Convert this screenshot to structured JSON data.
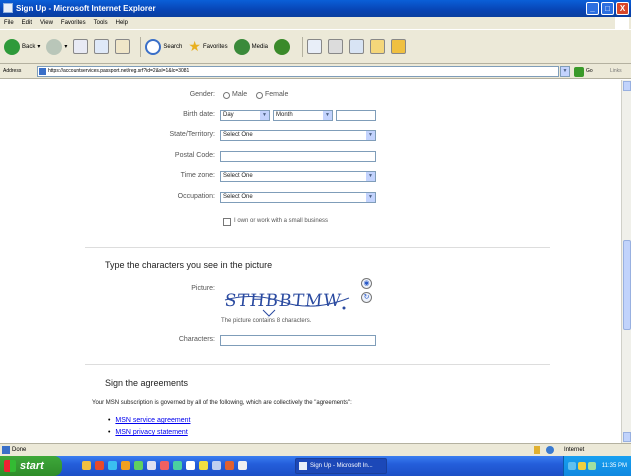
{
  "window": {
    "title": "Sign Up - Microsoft Internet Explorer",
    "buttons": [
      "_",
      "□",
      "X"
    ]
  },
  "menu": [
    "File",
    "Edit",
    "View",
    "Favorites",
    "Tools",
    "Help"
  ],
  "toolbar": {
    "back": "Back",
    "search": "Search",
    "favorites": "Favorites",
    "media": "Media"
  },
  "address": {
    "label": "Address",
    "url": "https://accountservices.passport.net/reg.srf?id=2&sl=1&lc=3081",
    "go": "Go",
    "links": "Links"
  },
  "form": {
    "gender_label": "Gender:",
    "gender_male": "Male",
    "gender_female": "Female",
    "birth_label": "Birth date:",
    "birth_day": "Day",
    "birth_month": "Month",
    "state_label": "State/Territory:",
    "state_value": "Select One",
    "postal_label": "Postal Code:",
    "timezone_label": "Time zone:",
    "timezone_value": "Select One",
    "occupation_label": "Occupation:",
    "occupation_value": "Select One",
    "business_checkbox": "I own or work with a small business"
  },
  "captcha": {
    "heading": "Type the characters you see in the picture",
    "picture_label": "Picture:",
    "picture_text": "STHBBTMW",
    "note": "The picture contains 8 characters.",
    "characters_label": "Characters:"
  },
  "agreements": {
    "heading": "Sign the agreements",
    "intro": "Your MSN subscription is governed by all of the following, which are collectively the \"agreements\":",
    "links": [
      "MSN service agreement",
      "MSN privacy statement"
    ]
  },
  "status": {
    "text": "Done",
    "zone": "Internet"
  },
  "taskbar": {
    "start": "start",
    "task": "Sign Up - Microsoft In...",
    "clock": "11:35 PM"
  }
}
